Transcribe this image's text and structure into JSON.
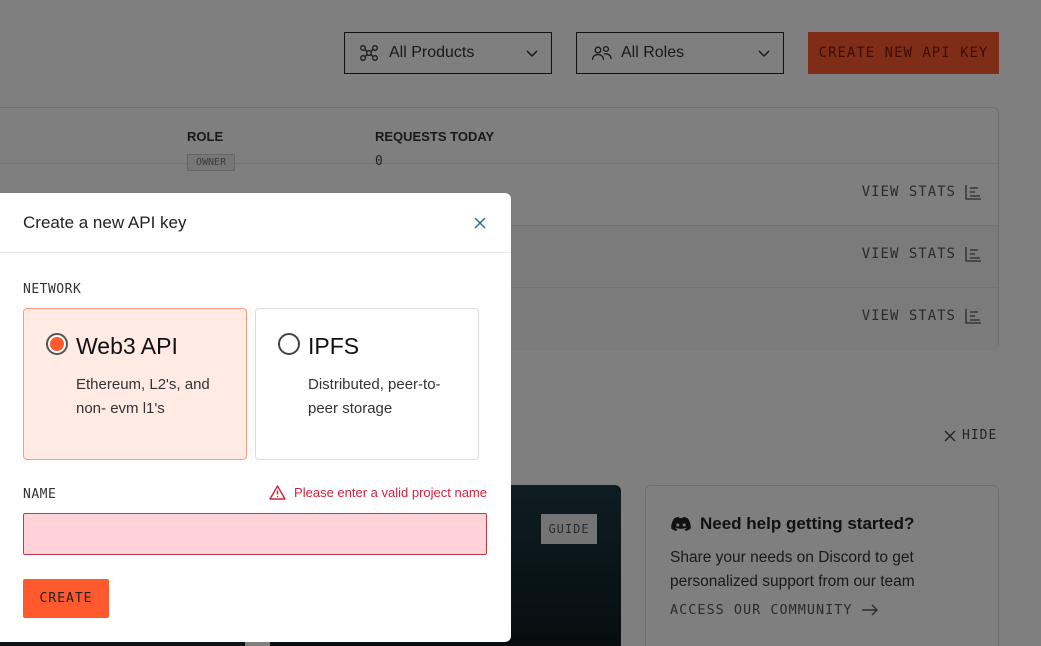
{
  "toolbar": {
    "products_filter": "All Products",
    "roles_filter": "All Roles",
    "create_key_label": "CREATE NEW API KEY"
  },
  "table": {
    "headers": {
      "role": "ROLE",
      "requests_today": "REQUESTS TODAY"
    },
    "rows": [
      {
        "role_badge": "OWNER",
        "requests": "0",
        "action": "VIEW STATS"
      },
      {
        "action": "VIEW STATS"
      },
      {
        "action": "VIEW STATS"
      }
    ]
  },
  "getting_started": {
    "hide_label": "HIDE",
    "guide_tag": "GUIDE",
    "help": {
      "title": "Need help getting started?",
      "text": "Share your needs on Discord to get personalized support from our team",
      "link": "ACCESS OUR COMMUNITY"
    }
  },
  "modal": {
    "title": "Create a new API key",
    "network_label": "NETWORK",
    "options": [
      {
        "title": "Web3 API",
        "description": "Ethereum, L2's, and non- evm l1's",
        "selected": true
      },
      {
        "title": "IPFS",
        "description": "Distributed, peer-to-peer storage",
        "selected": false
      }
    ],
    "name_label": "NAME",
    "name_error": "Please enter a valid project name",
    "name_value": "",
    "create_label": "CREATE"
  },
  "colors": {
    "accent": "#ff5a2e",
    "error": "#d8203a",
    "selected_card_bg": "#ffeae4",
    "input_error_bg": "#ffd3d8"
  },
  "icons": [
    "network-icon",
    "users-icon",
    "chevron-down-icon",
    "bar-chart-icon",
    "close-icon",
    "discord-icon",
    "arrow-right-icon",
    "warning-icon"
  ]
}
